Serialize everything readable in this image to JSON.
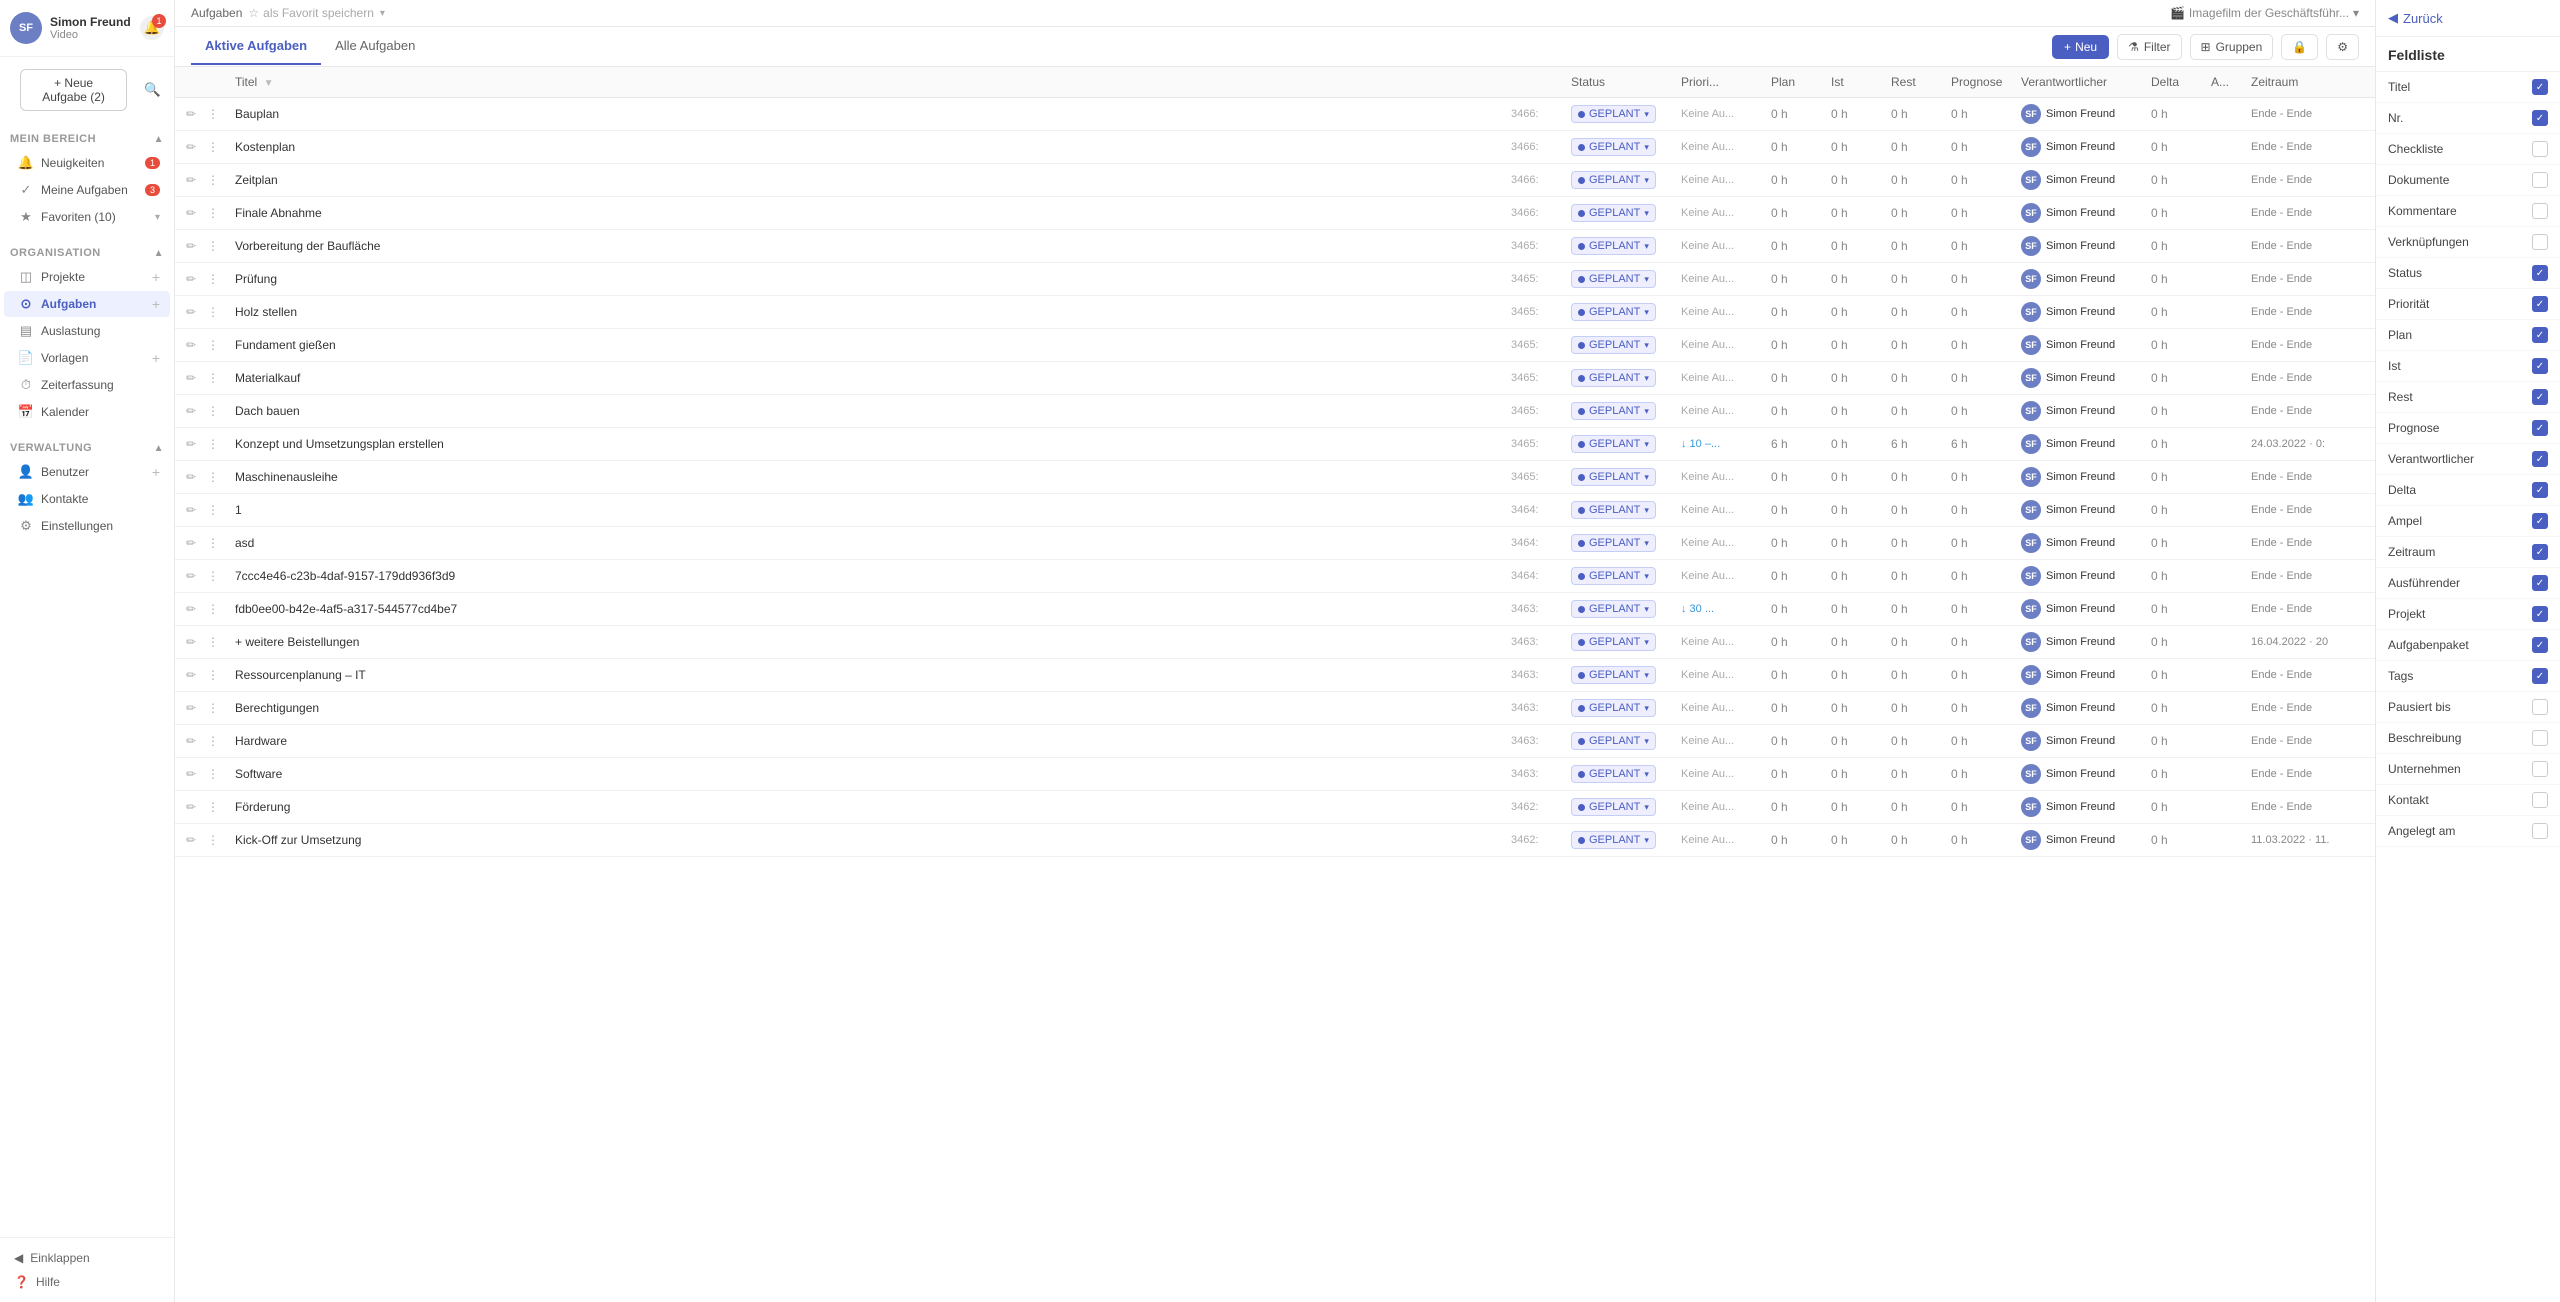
{
  "app": {
    "title": "Imagefilm der Geschäftsführ...",
    "dropdown_arrow": "▾"
  },
  "user": {
    "name": "Simon Freund",
    "subtitle": "Video",
    "avatar": "SF",
    "notification_count": "1"
  },
  "sidebar": {
    "new_task_label": "+ Neue Aufgabe (2)",
    "sections": [
      {
        "title": "Mein Bereich",
        "items": [
          {
            "id": "neuigkeiten",
            "label": "Neuigkeiten",
            "icon": "🔔",
            "badge": "1"
          },
          {
            "id": "meine-aufgaben",
            "label": "Meine Aufgaben",
            "icon": "✓",
            "badge": "3"
          },
          {
            "id": "favoriten",
            "label": "Favoriten (10)",
            "icon": "★",
            "expandable": true
          }
        ]
      },
      {
        "title": "Organisation",
        "items": [
          {
            "id": "projekte",
            "label": "Projekte",
            "icon": "◫",
            "plus": true
          },
          {
            "id": "aufgaben",
            "label": "Aufgaben",
            "icon": "⊙",
            "plus": true,
            "active": true
          },
          {
            "id": "auslastung",
            "label": "Auslastung",
            "icon": "▤"
          },
          {
            "id": "vorlagen",
            "label": "Vorlagen",
            "icon": "📄",
            "plus": true
          },
          {
            "id": "zeiterfassung",
            "label": "Zeiterfassung",
            "icon": "⏱"
          },
          {
            "id": "kalender",
            "label": "Kalender",
            "icon": "📅"
          }
        ]
      },
      {
        "title": "Verwaltung",
        "items": [
          {
            "id": "benutzer",
            "label": "Benutzer",
            "icon": "👤",
            "plus": true
          },
          {
            "id": "kontakte",
            "label": "Kontakte",
            "icon": "👥"
          },
          {
            "id": "einstellungen",
            "label": "Einstellungen",
            "icon": "⚙"
          }
        ]
      }
    ],
    "footer": [
      {
        "id": "einklappen",
        "label": "Einklappen",
        "icon": "◀"
      },
      {
        "id": "hilfe",
        "label": "Hilfe",
        "icon": "?"
      }
    ]
  },
  "topbar": {
    "breadcrumb1": "Aufgaben",
    "fav_label": "als Favorit speichern",
    "project_title": "Imagefilm der Geschäftsführ..."
  },
  "tabs": {
    "active_label": "Aktive Aufgaben",
    "all_label": "Alle Aufgaben"
  },
  "toolbar": {
    "neu_label": "Neu",
    "filter_label": "Filter",
    "gruppen_label": "Gruppen"
  },
  "table": {
    "columns": [
      "",
      "Titel",
      "",
      "Status",
      "Priori...",
      "Plan",
      "Ist",
      "Rest",
      "Prognose",
      "Verantwortlicher",
      "Delta",
      "A...",
      "Zeitraum"
    ],
    "rows": [
      {
        "id": "r1",
        "nr": "3466:",
        "title": "Bauplan",
        "status": "GEPLANT",
        "priority": "Keine Au...",
        "plan": "0 h",
        "ist": "0 h",
        "rest": "0 h",
        "prognose": "0 h",
        "person": "Simon Freund",
        "delta": "0 h",
        "ampel": "",
        "zeitraum": "Ende - Ende"
      },
      {
        "id": "r2",
        "nr": "3466:",
        "title": "Kostenplan",
        "status": "GEPLANT",
        "priority": "Keine Au...",
        "plan": "0 h",
        "ist": "0 h",
        "rest": "0 h",
        "prognose": "0 h",
        "person": "Simon Freund",
        "delta": "0 h",
        "ampel": "",
        "zeitraum": "Ende - Ende"
      },
      {
        "id": "r3",
        "nr": "3466:",
        "title": "Zeitplan",
        "status": "GEPLANT",
        "priority": "Keine Au...",
        "plan": "0 h",
        "ist": "0 h",
        "rest": "0 h",
        "prognose": "0 h",
        "person": "Simon Freund",
        "delta": "0 h",
        "ampel": "",
        "zeitraum": "Ende - Ende"
      },
      {
        "id": "r4",
        "nr": "3466:",
        "title": "Finale Abnahme",
        "status": "GEPLANT",
        "priority": "Keine Au...",
        "plan": "0 h",
        "ist": "0 h",
        "rest": "0 h",
        "prognose": "0 h",
        "person": "Simon Freund",
        "delta": "0 h",
        "ampel": "",
        "zeitraum": "Ende - Ende"
      },
      {
        "id": "r5",
        "nr": "3465:",
        "title": "Vorbereitung der Baufläche",
        "status": "GEPLANT",
        "priority": "Keine Au...",
        "plan": "0 h",
        "ist": "0 h",
        "rest": "0 h",
        "prognose": "0 h",
        "person": "Simon Freund",
        "delta": "0 h",
        "ampel": "",
        "zeitraum": "Ende - Ende"
      },
      {
        "id": "r6",
        "nr": "3465:",
        "title": "Prüfung",
        "status": "GEPLANT",
        "priority": "Keine Au...",
        "plan": "0 h",
        "ist": "0 h",
        "rest": "0 h",
        "prognose": "0 h",
        "person": "Simon Freund",
        "delta": "0 h",
        "ampel": "",
        "zeitraum": "Ende - Ende"
      },
      {
        "id": "r7",
        "nr": "3465:",
        "title": "Holz stellen",
        "status": "GEPLANT",
        "priority": "Keine Au...",
        "plan": "0 h",
        "ist": "0 h",
        "rest": "0 h",
        "prognose": "0 h",
        "person": "Simon Freund",
        "delta": "0 h",
        "ampel": "",
        "zeitraum": "Ende - Ende"
      },
      {
        "id": "r8",
        "nr": "3465:",
        "title": "Fundament gießen",
        "status": "GEPLANT",
        "priority": "Keine Au...",
        "plan": "0 h",
        "ist": "0 h",
        "rest": "0 h",
        "prognose": "0 h",
        "person": "Simon Freund",
        "delta": "0 h",
        "ampel": "",
        "zeitraum": "Ende - Ende"
      },
      {
        "id": "r9",
        "nr": "3465:",
        "title": "Materialkauf",
        "status": "GEPLANT",
        "priority": "Keine Au...",
        "plan": "0 h",
        "ist": "0 h",
        "rest": "0 h",
        "prognose": "0 h",
        "person": "Simon Freund",
        "delta": "0 h",
        "ampel": "",
        "zeitraum": "Ende - Ende"
      },
      {
        "id": "r10",
        "nr": "3465:",
        "title": "Dach bauen",
        "status": "GEPLANT",
        "priority": "Keine Au...",
        "plan": "0 h",
        "ist": "0 h",
        "rest": "0 h",
        "prognose": "0 h",
        "person": "Simon Freund",
        "delta": "0 h",
        "ampel": "",
        "zeitraum": "Ende - Ende"
      },
      {
        "id": "r11",
        "nr": "3465:",
        "title": "Konzept und Umsetzungsplan erstellen",
        "status": "GEPLANT",
        "priority": "↓ 10 –...",
        "plan": "6 h",
        "ist": "0 h",
        "rest": "6 h",
        "prognose": "6 h",
        "person": "Simon Freund",
        "delta": "0 h",
        "ampel": "green",
        "zeitraum": "24.03.2022 · 0:"
      },
      {
        "id": "r12",
        "nr": "3465:",
        "title": "Maschinenausleihe",
        "status": "GEPLANT",
        "priority": "Keine Au...",
        "plan": "0 h",
        "ist": "0 h",
        "rest": "0 h",
        "prognose": "0 h",
        "person": "Simon Freund",
        "delta": "0 h",
        "ampel": "",
        "zeitraum": "Ende - Ende"
      },
      {
        "id": "r13",
        "nr": "3464:",
        "title": "1",
        "status": "GEPLANT",
        "priority": "Keine Au...",
        "plan": "0 h",
        "ist": "0 h",
        "rest": "0 h",
        "prognose": "0 h",
        "person": "Simon Freund",
        "delta": "0 h",
        "ampel": "",
        "zeitraum": "Ende - Ende"
      },
      {
        "id": "r14",
        "nr": "3464:",
        "title": "asd",
        "status": "GEPLANT",
        "priority": "Keine Au...",
        "plan": "0 h",
        "ist": "0 h",
        "rest": "0 h",
        "prognose": "0 h",
        "person": "Simon Freund",
        "delta": "0 h",
        "ampel": "",
        "zeitraum": "Ende - Ende"
      },
      {
        "id": "r15",
        "nr": "3464:",
        "title": "7ccc4e46-c23b-4daf-9157-179dd936f3d9",
        "status": "GEPLANT",
        "priority": "Keine Au...",
        "plan": "0 h",
        "ist": "0 h",
        "rest": "0 h",
        "prognose": "0 h",
        "person": "Simon Freund",
        "delta": "0 h",
        "ampel": "",
        "zeitraum": "Ende - Ende"
      },
      {
        "id": "r16",
        "nr": "3463:",
        "title": "fdb0ee00-b42e-4af5-a317-544577cd4be7",
        "status": "GEPLANT",
        "priority": "↓ 30 ...",
        "plan": "0 h",
        "ist": "0 h",
        "rest": "0 h",
        "prognose": "0 h",
        "person": "Simon Freund",
        "delta": "0 h",
        "ampel": "",
        "zeitraum": "Ende - Ende"
      },
      {
        "id": "r17",
        "nr": "3463:",
        "title": "+ weitere Beistellungen",
        "status": "GEPLANT",
        "priority": "Keine Au...",
        "plan": "0 h",
        "ist": "0 h",
        "rest": "0 h",
        "prognose": "0 h",
        "person": "Simon Freund",
        "delta": "0 h",
        "ampel": "green",
        "zeitraum": "16.04.2022 · 20"
      },
      {
        "id": "r18",
        "nr": "3463:",
        "title": "Ressourcenplanung – IT",
        "status": "GEPLANT",
        "priority": "Keine Au...",
        "plan": "0 h",
        "ist": "0 h",
        "rest": "0 h",
        "prognose": "0 h",
        "person": "Simon Freund",
        "delta": "0 h",
        "ampel": "",
        "zeitraum": "Ende - Ende"
      },
      {
        "id": "r19",
        "nr": "3463:",
        "title": "Berechtigungen",
        "status": "GEPLANT",
        "priority": "Keine Au...",
        "plan": "0 h",
        "ist": "0 h",
        "rest": "0 h",
        "prognose": "0 h",
        "person": "Simon Freund",
        "delta": "0 h",
        "ampel": "",
        "zeitraum": "Ende - Ende"
      },
      {
        "id": "r20",
        "nr": "3463:",
        "title": "Hardware",
        "status": "GEPLANT",
        "priority": "Keine Au...",
        "plan": "0 h",
        "ist": "0 h",
        "rest": "0 h",
        "prognose": "0 h",
        "person": "Simon Freund",
        "delta": "0 h",
        "ampel": "",
        "zeitraum": "Ende - Ende"
      },
      {
        "id": "r21",
        "nr": "3463:",
        "title": "Software",
        "status": "GEPLANT",
        "priority": "Keine Au...",
        "plan": "0 h",
        "ist": "0 h",
        "rest": "0 h",
        "prognose": "0 h",
        "person": "Simon Freund",
        "delta": "0 h",
        "ampel": "",
        "zeitraum": "Ende - Ende"
      },
      {
        "id": "r22",
        "nr": "3462:",
        "title": "Förderung",
        "status": "GEPLANT",
        "priority": "Keine Au...",
        "plan": "0 h",
        "ist": "0 h",
        "rest": "0 h",
        "prognose": "0 h",
        "person": "Simon Freund",
        "delta": "0 h",
        "ampel": "",
        "zeitraum": "Ende - Ende"
      },
      {
        "id": "r23",
        "nr": "3462:",
        "title": "Kick-Off zur Umsetzung",
        "status": "GEPLANT",
        "priority": "Keine Au...",
        "plan": "0 h",
        "ist": "0 h",
        "rest": "0 h",
        "prognose": "0 h",
        "person": "Simon Freund",
        "delta": "0 h",
        "ampel": "red",
        "zeitraum": "11.03.2022 · 11."
      }
    ]
  },
  "right_panel": {
    "back_label": "Zurück",
    "title": "Feldliste",
    "fields": [
      {
        "id": "titel",
        "label": "Titel",
        "checked": true
      },
      {
        "id": "nr",
        "label": "Nr.",
        "checked": true
      },
      {
        "id": "checkliste",
        "label": "Checkliste",
        "checked": false
      },
      {
        "id": "dokumente",
        "label": "Dokumente",
        "checked": false
      },
      {
        "id": "kommentare",
        "label": "Kommentare",
        "checked": false
      },
      {
        "id": "verknuepfungen",
        "label": "Verknüpfungen",
        "checked": false
      },
      {
        "id": "status",
        "label": "Status",
        "checked": true
      },
      {
        "id": "prioritaet",
        "label": "Priorität",
        "checked": true
      },
      {
        "id": "plan",
        "label": "Plan",
        "checked": true
      },
      {
        "id": "ist",
        "label": "Ist",
        "checked": true
      },
      {
        "id": "rest",
        "label": "Rest",
        "checked": true
      },
      {
        "id": "prognose",
        "label": "Prognose",
        "checked": true
      },
      {
        "id": "verantwortlicher",
        "label": "Verantwortlicher",
        "checked": true
      },
      {
        "id": "delta",
        "label": "Delta",
        "checked": true
      },
      {
        "id": "ampel",
        "label": "Ampel",
        "checked": true
      },
      {
        "id": "zeitraum",
        "label": "Zeitraum",
        "checked": true
      },
      {
        "id": "ausfuehrender",
        "label": "Ausführender",
        "checked": true
      },
      {
        "id": "projekt",
        "label": "Projekt",
        "checked": true
      },
      {
        "id": "aufgabenpaket",
        "label": "Aufgabenpaket",
        "checked": true
      },
      {
        "id": "tags",
        "label": "Tags",
        "checked": true
      },
      {
        "id": "pausiert-bis",
        "label": "Pausiert bis",
        "checked": false
      },
      {
        "id": "beschreibung",
        "label": "Beschreibung",
        "checked": false
      },
      {
        "id": "unternehmen",
        "label": "Unternehmen",
        "checked": false
      },
      {
        "id": "kontakt",
        "label": "Kontakt",
        "checked": false
      },
      {
        "id": "angelegt-am",
        "label": "Angelegt am",
        "checked": false
      }
    ]
  }
}
